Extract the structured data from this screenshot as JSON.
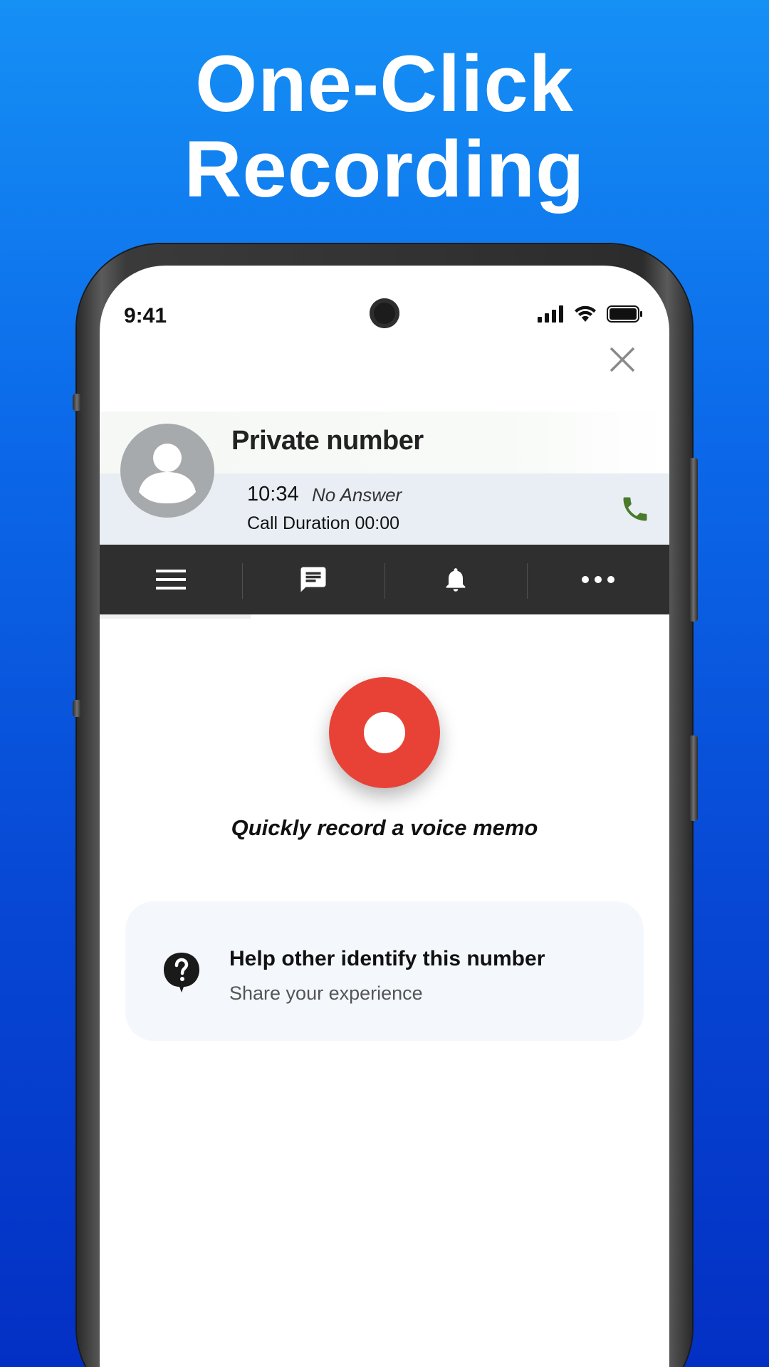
{
  "headline": {
    "line1": "One-Click",
    "line2": "Recording"
  },
  "status_bar": {
    "time": "9:41",
    "icons": [
      "signal-icon",
      "wifi-icon",
      "battery-icon"
    ]
  },
  "caller": {
    "name": "Private number",
    "time": "10:34",
    "status": "No Answer",
    "duration": "Call Duration 00:00",
    "avatar_icon": "person-icon",
    "call_icon_color": "#4a7a2a"
  },
  "toolbar": {
    "tabs": [
      "menu-icon",
      "message-icon",
      "bell-icon",
      "more-icon"
    ],
    "selected_index": 0
  },
  "record": {
    "caption": "Quickly record a voice memo",
    "button_color": "#e84236"
  },
  "help": {
    "title": "Help other identify this number",
    "subtitle": "Share your experience",
    "icon": "question-bubble-icon"
  },
  "colors": {
    "background_top": "#1590f5",
    "background_bottom": "#0330c4",
    "toolbar": "#2f2f30"
  }
}
